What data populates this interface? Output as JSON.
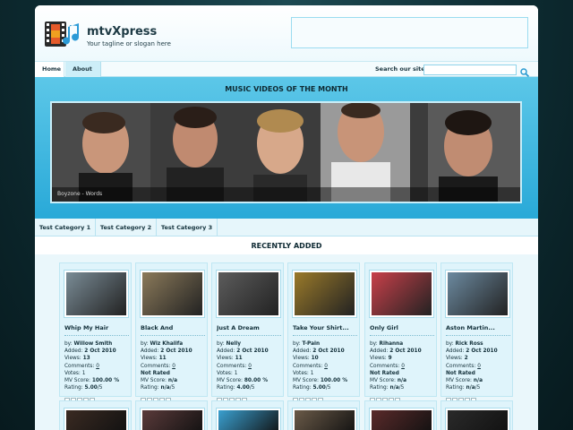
{
  "site": {
    "title": "mtvXpress",
    "tagline": "Your tagline or slogan here"
  },
  "nav": {
    "items": [
      {
        "label": "Home"
      },
      {
        "label": "About"
      }
    ],
    "search_label": "Search our site",
    "search_placeholder": ""
  },
  "featured": {
    "title": "MUSIC  VIDEOS  OF  THE  MONTH",
    "caption": "Boyzone - Words"
  },
  "categories": [
    {
      "label": "Test Category 1"
    },
    {
      "label": "Test Category 2"
    },
    {
      "label": "Test Category 3"
    }
  ],
  "recent": {
    "title": "RECENTLY ADDED",
    "videos": [
      {
        "title": "Whip My Hair",
        "by": "Willow Smith",
        "added": "2 Oct 2010",
        "views": "13",
        "comments": "0",
        "votes": "1",
        "mv_score": "100.00 %",
        "rating": "5.00",
        "thumb_color": "#7a8c96"
      },
      {
        "title": "Black And ",
        "by": "Wiz Khalifa",
        "added": "2 Oct 2010",
        "views": "11",
        "comments": "0",
        "votes": "Not Rated",
        "mv_score": "n/a",
        "rating": "n/a",
        "thumb_color": "#8b7a5a"
      },
      {
        "title": "Just A Dream",
        "by": "Nelly",
        "added": "2 Oct 2010",
        "views": "11",
        "comments": "0",
        "votes": "1",
        "mv_score": "80.00 %",
        "rating": "4.00",
        "thumb_color": "#5c5c5c"
      },
      {
        "title": "Take Your Shirt...",
        "by": "T-Pain",
        "added": "2 Oct 2010",
        "views": "10",
        "comments": "0",
        "votes": "1",
        "mv_score": "100.00 %",
        "rating": "5.00",
        "thumb_color": "#9a7a2a"
      },
      {
        "title": "Only Girl",
        "by": "Rihanna",
        "added": "2 Oct 2010",
        "views": "9",
        "comments": "0",
        "votes": "Not Rated",
        "mv_score": "n/a",
        "rating": "n/a",
        "thumb_color": "#c8404a"
      },
      {
        "title": "Aston Martin...",
        "by": "Rick Ross",
        "added": "2 Oct 2010",
        "views": "2",
        "comments": "0",
        "votes": "Not Rated",
        "mv_score": "n/a",
        "rating": "n/a",
        "thumb_color": "#6c8aa0"
      }
    ],
    "labels": {
      "by": "by:",
      "added": "Added:",
      "views": "Views:",
      "comments": "Comments:",
      "votes": "Votes:",
      "mv_score": "MV Score:",
      "rating": "Rating:",
      "rating_suffix": "/5"
    },
    "second_row_thumb_colors": [
      "#3a2a22",
      "#5a3a3a",
      "#3aa0d0",
      "#6a5a48",
      "#5a2a2a",
      "#2a2a2a"
    ]
  },
  "colors": {
    "accent": "#29a9d8",
    "background": "#0c2a30"
  }
}
